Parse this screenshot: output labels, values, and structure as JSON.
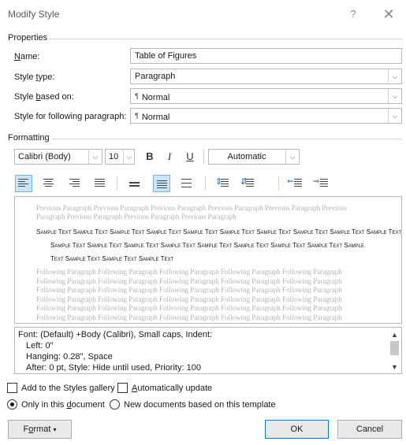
{
  "dialog": {
    "title": "Modify Style",
    "help_icon": "?",
    "close_icon": "✕"
  },
  "properties": {
    "section_label": "Properties",
    "name": {
      "label_accel": "N",
      "label_rest": "ame:",
      "value": "Table of Figures"
    },
    "style_type": {
      "label_pre": "Style ",
      "label_accel": "t",
      "label_rest": "ype:",
      "value": "Paragraph"
    },
    "style_based_on": {
      "label_pre": "Style ",
      "label_accel": "b",
      "label_rest": "ased on:",
      "value": "Normal",
      "icon": "¶"
    },
    "style_following": {
      "label_pre": "Style for following paragraph:",
      "value": "Normal",
      "icon": "¶"
    }
  },
  "formatting": {
    "section_label": "Formatting",
    "font": "Calibri (Body)",
    "size": "10",
    "bold": "B",
    "italic": "I",
    "underline": "U",
    "color": "Automatic"
  },
  "preview": {
    "previous_paragraph": "Previous Paragraph Previous Paragraph Previous Paragraph Previous Paragraph Previous Paragraph Previous Paragraph Previous Paragraph Previous Paragraph Previous Paragraph",
    "sample_line_1": "Sample Text Sample Text Sample Text Sample Text Sample Text Sample Text Sample Text Sample Text Sample Text Sample Text",
    "sample_line_2": "Sample Text Sample Text Sample Text Sample Text Sample Text Sample Text Sample Text Sample Text Sample",
    "sample_line_3": "Text Sample Text Sample Text Sample Text",
    "following_paragraph": "Following Paragraph Following Paragraph Following Paragraph Following Paragraph Following Paragraph Following Paragraph Following Paragraph Following Paragraph Following Paragraph Following Paragraph Following Paragraph Following Paragraph Following Paragraph Following Paragraph Following Paragraph Following Paragraph Following Paragraph Following Paragraph Following Paragraph Following Paragraph Following Paragraph Following Paragraph Following Paragraph Following Paragraph Following Paragraph Following Paragraph Following Paragraph Following Paragraph Following Paragraph Following Paragraph"
  },
  "description": {
    "line1": "Font: (Default) +Body (Calibri), Small caps, Indent:",
    "line2": "Left:  0\"",
    "line3": "Hanging:  0.28\", Space",
    "line4": "After:  0 pt, Style: Hide until used, Priority: 100"
  },
  "options": {
    "add_gallery": "Add to the Styles gallery",
    "auto_update_accel": "A",
    "auto_update_rest": "utomatically update",
    "only_doc_pre": "Only in this ",
    "only_doc_accel": "d",
    "only_doc_rest": "ocument",
    "new_docs": "New documents based on this template"
  },
  "buttons": {
    "format_pre": "F",
    "format_accel": "o",
    "format_rest": "rmat",
    "format_caret": "▾",
    "ok": "OK",
    "cancel": "Cancel"
  }
}
